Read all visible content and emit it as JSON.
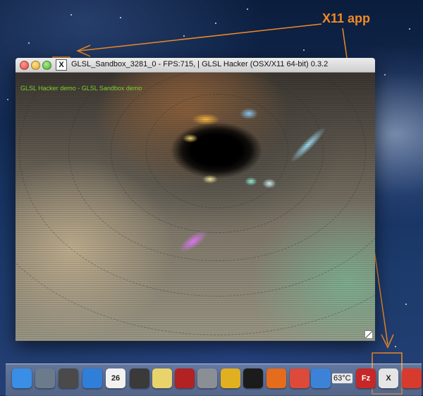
{
  "annotation": {
    "label": "X11 app",
    "color": "#f08a24"
  },
  "window": {
    "title": "GLSL_Sandbox_3281_0 - FPS:715,  | GLSL Hacker (OSX/X11 64-bit) 0.3.2",
    "icon": "X",
    "demo_label": "GLSL Hacker demo - GLSL Sandbox demo"
  },
  "dock": {
    "items": [
      {
        "name": "Finder",
        "icon": "finder-icon",
        "color": "#3a8ee6"
      },
      {
        "name": "Launchpad",
        "icon": "rocket-icon",
        "color": "#6c7b8c"
      },
      {
        "name": "Migration Assistant",
        "icon": "migration-icon",
        "color": "#4a4a4a"
      },
      {
        "name": "Safari",
        "icon": "compass-icon",
        "color": "#2f7fd8"
      },
      {
        "name": "Calendar",
        "icon": "calendar-icon",
        "color": "#f1f1f1",
        "text": "26"
      },
      {
        "name": "FaceTime",
        "icon": "camera-icon",
        "color": "#3a3a3a"
      },
      {
        "name": "Stickies",
        "icon": "notes-icon",
        "color": "#e9d36b"
      },
      {
        "name": "Photo Booth",
        "icon": "photobooth-icon",
        "color": "#b22222"
      },
      {
        "name": "System Preferences",
        "icon": "gear-icon",
        "color": "#8a8f96"
      },
      {
        "name": "Wi-Fi App",
        "icon": "wireless-icon",
        "color": "#e0b020"
      },
      {
        "name": "Terminal",
        "icon": "terminal-icon",
        "color": "#1b1b1b"
      },
      {
        "name": "Firefox",
        "icon": "firefox-icon",
        "color": "#e56c1c"
      },
      {
        "name": "Chrome",
        "icon": "chrome-icon",
        "color": "#dd4a3a"
      },
      {
        "name": "iTunes",
        "icon": "music-icon",
        "color": "#3c83d8"
      },
      {
        "name": "FileZilla",
        "icon": "filezilla-icon",
        "color": "#c62828",
        "text": "Fz"
      },
      {
        "name": "X11",
        "icon": "x11-icon",
        "color": "#e5e5e5",
        "text": "X"
      },
      {
        "name": "Strawberry",
        "icon": "strawberry-icon",
        "color": "#d93a2e"
      }
    ],
    "temperature": "63°C"
  }
}
